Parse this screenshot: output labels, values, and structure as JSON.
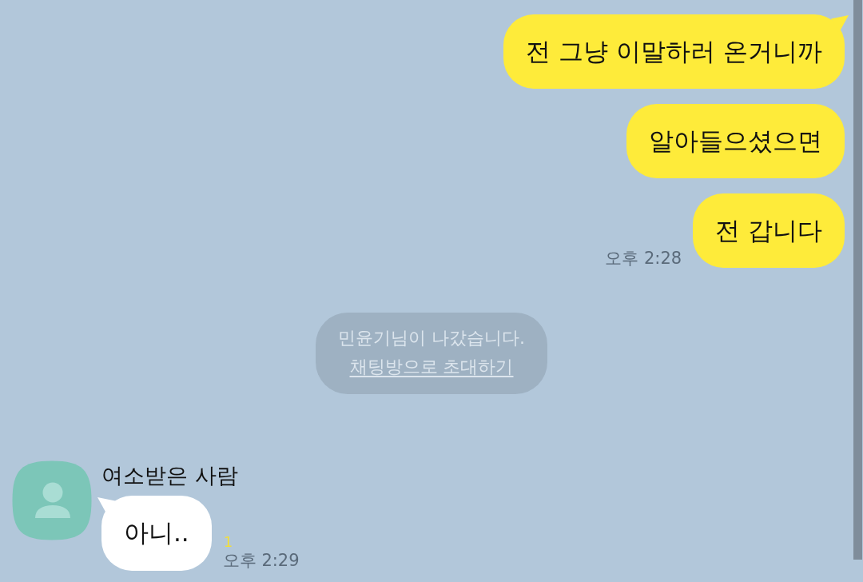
{
  "chat": [
    {
      "kind": "sent",
      "bubbles": [
        "전 그냥 이말하러 온거니까",
        "알아들으셨으면",
        "전 갑니다"
      ],
      "time": "오후 2:28"
    },
    {
      "kind": "notice",
      "text": "민윤기님이 나갔습니다.",
      "link": "채팅방으로 초대하기"
    },
    {
      "kind": "received",
      "sender": "여소받은 사람",
      "bubbles": [
        "아니.."
      ],
      "unread": "1",
      "time": "오후 2:29"
    }
  ]
}
